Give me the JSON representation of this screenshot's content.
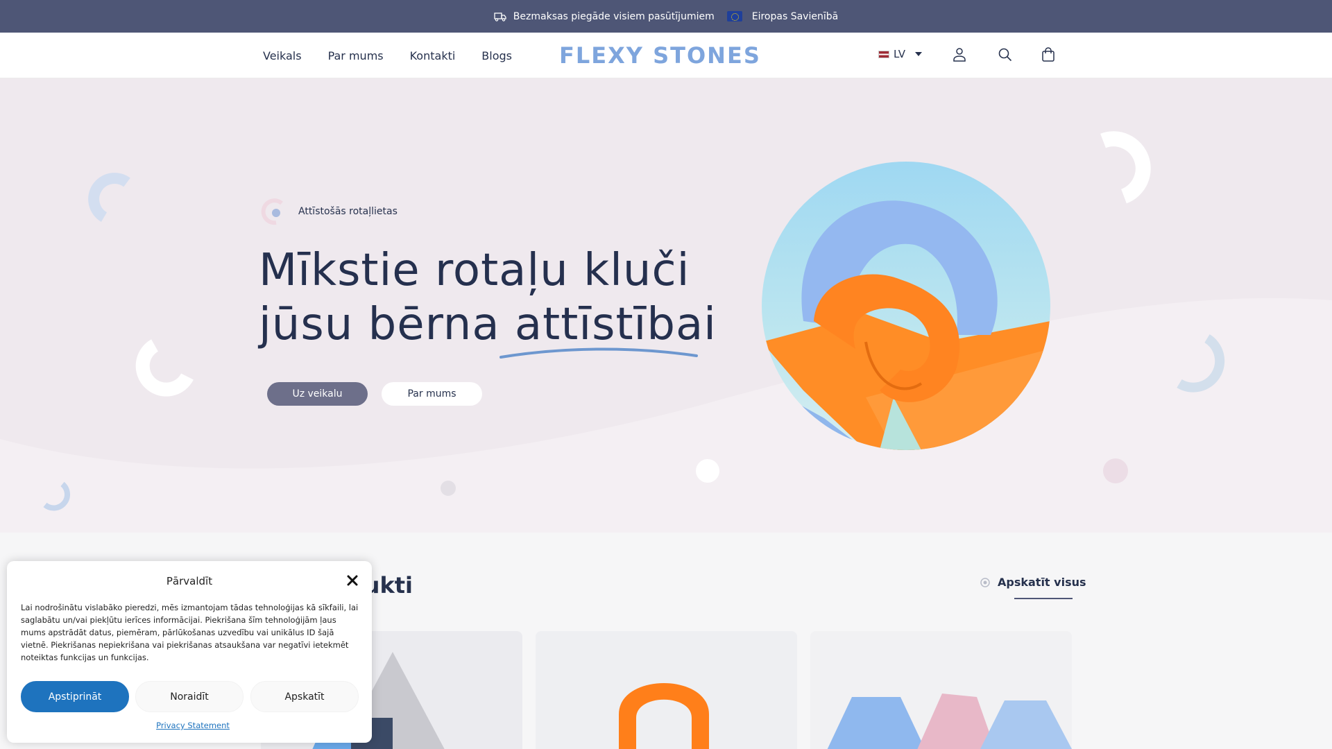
{
  "announcement": {
    "shipping": "Bezmaksas piegāde visiem pasūtījumiem",
    "region": "Eiropas Savienībā"
  },
  "header": {
    "nav": [
      "Veikals",
      "Par mums",
      "Kontakti",
      "Blogs"
    ],
    "logo": "FLEXY STONES",
    "language": "LV",
    "icons": [
      "account-icon",
      "search-icon",
      "cart-icon"
    ]
  },
  "hero": {
    "eyebrow": "Attīstošās rotaļlietas",
    "title_line1": "Mīkstie rotaļu kluči",
    "title_line2_a": "jūsu bērna ",
    "title_line2_b": "attīstībai",
    "btn_shop": "Uz veikalu",
    "btn_about": "Par mums"
  },
  "products": {
    "title": "kie produkti",
    "view_all": "Apskatīt visus"
  },
  "cookie": {
    "title": "Pārvaldīt",
    "text": "Lai nodrošinātu vislabāko pieredzi, mēs izmantojam tādas tehnoloģijas kā sīkfaili, lai saglabātu un/vai piekļūtu ierīces informācijai. Piekrišana šīm tehnoloģijām ļaus mums apstrādāt datus, piemēram, pārlūkošanas uzvedību vai unikālus ID šajā vietnē. Piekrišanas nepiekrišana vai piekrišanas atsaukšana var negatīvi ietekmēt noteiktas funkcijas un funkcijas.",
    "accept": "Apstiprināt",
    "deny": "Noraidīt",
    "view": "Apskatīt",
    "privacy": "Privacy Statement"
  },
  "colors": {
    "topbar": "#4e5676",
    "logo": "#7ea5dd",
    "hero_bg": "#efe9ee",
    "accent_blue": "#1e73be",
    "orange": "#ff8c1f"
  }
}
